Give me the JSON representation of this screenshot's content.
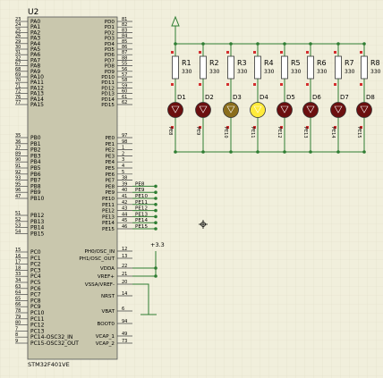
{
  "schematic": {
    "chip": {
      "ref": "U2",
      "part": "STM32F401VE",
      "left_pins": [
        {
          "num": "23",
          "name": "PA0"
        },
        {
          "num": "24",
          "name": "PA1"
        },
        {
          "num": "25",
          "name": "PA2"
        },
        {
          "num": "26",
          "name": "PA3"
        },
        {
          "num": "29",
          "name": "PA4"
        },
        {
          "num": "30",
          "name": "PA5"
        },
        {
          "num": "31",
          "name": "PA6"
        },
        {
          "num": "32",
          "name": "PA7"
        },
        {
          "num": "67",
          "name": "PA8"
        },
        {
          "num": "68",
          "name": "PA9"
        },
        {
          "num": "69",
          "name": "PA10"
        },
        {
          "num": "70",
          "name": "PA11"
        },
        {
          "num": "71",
          "name": "PA12"
        },
        {
          "num": "72",
          "name": "PA13"
        },
        {
          "num": "76",
          "name": "PA14"
        },
        {
          "num": "77",
          "name": "PA15"
        },
        {
          "num": "35",
          "name": "PB0"
        },
        {
          "num": "36",
          "name": "PB1"
        },
        {
          "num": "37",
          "name": "PB2"
        },
        {
          "num": "89",
          "name": "PB3"
        },
        {
          "num": "90",
          "name": "PB4"
        },
        {
          "num": "91",
          "name": "PB5"
        },
        {
          "num": "92",
          "name": "PB6"
        },
        {
          "num": "93",
          "name": "PB7"
        },
        {
          "num": "95",
          "name": "PB8"
        },
        {
          "num": "96",
          "name": "PB9"
        },
        {
          "num": "47",
          "name": "PB10"
        },
        {
          "num": "51",
          "name": "PB12"
        },
        {
          "num": "52",
          "name": "PB13"
        },
        {
          "num": "53",
          "name": "PB14"
        },
        {
          "num": "54",
          "name": "PB15"
        },
        {
          "num": "15",
          "name": "PC0"
        },
        {
          "num": "16",
          "name": "PC1"
        },
        {
          "num": "17",
          "name": "PC2"
        },
        {
          "num": "18",
          "name": "PC3"
        },
        {
          "num": "33",
          "name": "PC4"
        },
        {
          "num": "34",
          "name": "PC5"
        },
        {
          "num": "63",
          "name": "PC6"
        },
        {
          "num": "64",
          "name": "PC7"
        },
        {
          "num": "65",
          "name": "PC8"
        },
        {
          "num": "66",
          "name": "PC9"
        },
        {
          "num": "78",
          "name": "PC10"
        },
        {
          "num": "79",
          "name": "PC11"
        },
        {
          "num": "80",
          "name": "PC12"
        },
        {
          "num": "7",
          "name": "PC13"
        },
        {
          "num": "8",
          "name": "PC14-OSC32_IN"
        },
        {
          "num": "9",
          "name": "PC15-OSC32_OUT"
        }
      ],
      "right_pins": [
        {
          "num": "81",
          "name": "PD0"
        },
        {
          "num": "82",
          "name": "PD1"
        },
        {
          "num": "83",
          "name": "PD2"
        },
        {
          "num": "84",
          "name": "PD3"
        },
        {
          "num": "85",
          "name": "PD4"
        },
        {
          "num": "86",
          "name": "PD5"
        },
        {
          "num": "87",
          "name": "PD6"
        },
        {
          "num": "88",
          "name": "PD7"
        },
        {
          "num": "55",
          "name": "PD8"
        },
        {
          "num": "56",
          "name": "PD9"
        },
        {
          "num": "57",
          "name": "PD10"
        },
        {
          "num": "58",
          "name": "PD11"
        },
        {
          "num": "59",
          "name": "PD12"
        },
        {
          "num": "60",
          "name": "PD13"
        },
        {
          "num": "61",
          "name": "PD14"
        },
        {
          "num": "62",
          "name": "PD15"
        },
        {
          "num": "97",
          "name": "PE0"
        },
        {
          "num": "98",
          "name": "PE1"
        },
        {
          "num": "1",
          "name": "PE2"
        },
        {
          "num": "2",
          "name": "PE3"
        },
        {
          "num": "3",
          "name": "PE4"
        },
        {
          "num": "4",
          "name": "PE5"
        },
        {
          "num": "5",
          "name": "PE6"
        },
        {
          "num": "38",
          "name": "PE7"
        },
        {
          "num": "39",
          "name": "PE8"
        },
        {
          "num": "40",
          "name": "PE9"
        },
        {
          "num": "41",
          "name": "PE10"
        },
        {
          "num": "42",
          "name": "PE11"
        },
        {
          "num": "43",
          "name": "PE12"
        },
        {
          "num": "44",
          "name": "PE13"
        },
        {
          "num": "45",
          "name": "PE14"
        },
        {
          "num": "46",
          "name": "PE15"
        },
        {
          "num": "12",
          "name": "PH0/OSC_IN"
        },
        {
          "num": "13",
          "name": "PH1/OSC_OUT"
        },
        {
          "num": "22",
          "name": "VDDA"
        },
        {
          "num": "21",
          "name": "VREF+"
        },
        {
          "num": "20",
          "name": "VSSA/VREF-"
        },
        {
          "num": "14",
          "name": "NRST"
        },
        {
          "num": "6",
          "name": "VBAT"
        },
        {
          "num": "94",
          "name": "BOOT0"
        },
        {
          "num": "49",
          "name": "VCAP_1"
        },
        {
          "num": "73",
          "name": "VCAP_2"
        }
      ],
      "net_labels": [
        "PE8",
        "PE9",
        "PE10",
        "PE11",
        "PE12",
        "PE13",
        "PE14",
        "PE15"
      ],
      "supply_label": "+3.3"
    },
    "resistors": [
      {
        "ref": "R1",
        "value": "330"
      },
      {
        "ref": "R2",
        "value": "330"
      },
      {
        "ref": "R3",
        "value": "330"
      },
      {
        "ref": "R4",
        "value": "330"
      },
      {
        "ref": "R5",
        "value": "330"
      },
      {
        "ref": "R6",
        "value": "330"
      },
      {
        "ref": "R7",
        "value": "330"
      },
      {
        "ref": "R8",
        "value": "330"
      }
    ],
    "leds": [
      {
        "ref": "D1",
        "net": "PE8",
        "state": "off"
      },
      {
        "ref": "D2",
        "net": "PE9",
        "state": "off"
      },
      {
        "ref": "D3",
        "net": "PE10",
        "state": "dim"
      },
      {
        "ref": "D4",
        "net": "PE11",
        "state": "on"
      },
      {
        "ref": "D5",
        "net": "PE12",
        "state": "off"
      },
      {
        "ref": "D6",
        "net": "PE13",
        "state": "off"
      },
      {
        "ref": "D7",
        "net": "PE14",
        "state": "off"
      },
      {
        "ref": "D8",
        "net": "PE15",
        "state": "off"
      }
    ],
    "colors": {
      "background": "#f1efdc",
      "grid": "#e1dec8",
      "chip_body": "#c9c7ad",
      "wire": "#2e7d32",
      "pin_marker": "#d32f2f",
      "led_off": "#6b0f0f",
      "led_dim": "#8a6d1c",
      "led_on": "#ffeb3b",
      "text": "#000000"
    }
  }
}
